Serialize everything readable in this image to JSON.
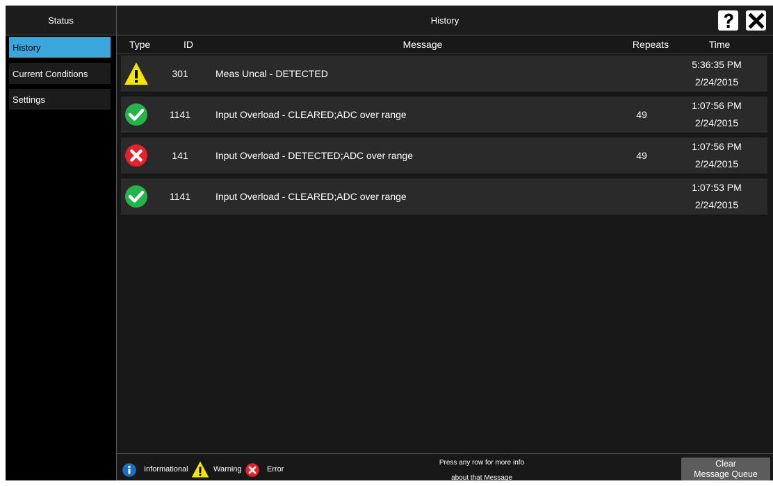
{
  "sidebar": {
    "header": "Status",
    "items": [
      {
        "label": "History",
        "active": true
      },
      {
        "label": "Current Conditions",
        "active": false
      },
      {
        "label": "Settings",
        "active": false
      }
    ]
  },
  "main": {
    "title": "History",
    "help_icon": "help-icon",
    "close_icon": "close-icon",
    "columns": {
      "type": "Type",
      "id": "ID",
      "message": "Message",
      "repeats": "Repeats",
      "time": "Time"
    },
    "rows": [
      {
        "type": "warning",
        "id": "301",
        "message": "Meas Uncal - DETECTED",
        "repeats": "",
        "time": "5:36:35 PM",
        "date": "2/24/2015"
      },
      {
        "type": "cleared",
        "id": "1141",
        "message": "Input Overload - CLEARED;ADC over range",
        "repeats": "49",
        "time": "1:07:56 PM",
        "date": "2/24/2015"
      },
      {
        "type": "error",
        "id": "141",
        "message": "Input Overload - DETECTED;ADC over range",
        "repeats": "49",
        "time": "1:07:56 PM",
        "date": "2/24/2015"
      },
      {
        "type": "cleared",
        "id": "1141",
        "message": "Input Overload - CLEARED;ADC over range",
        "repeats": "",
        "time": "1:07:53 PM",
        "date": "2/24/2015"
      }
    ]
  },
  "footer": {
    "legend": [
      {
        "icon": "info-icon",
        "label": "Informational"
      },
      {
        "icon": "warning-icon",
        "label": "Warning"
      },
      {
        "icon": "error-icon",
        "label": "Error"
      }
    ],
    "hint_line1": "Press any row for more info",
    "hint_line2": "about that Message",
    "clear_button_line1": "Clear",
    "clear_button_line2": "Message Queue"
  },
  "colors": {
    "accent": "#3aa6dc",
    "warning": "#f5e600",
    "success": "#25b34b",
    "error": "#e8202a",
    "info": "#1a6fc4"
  }
}
